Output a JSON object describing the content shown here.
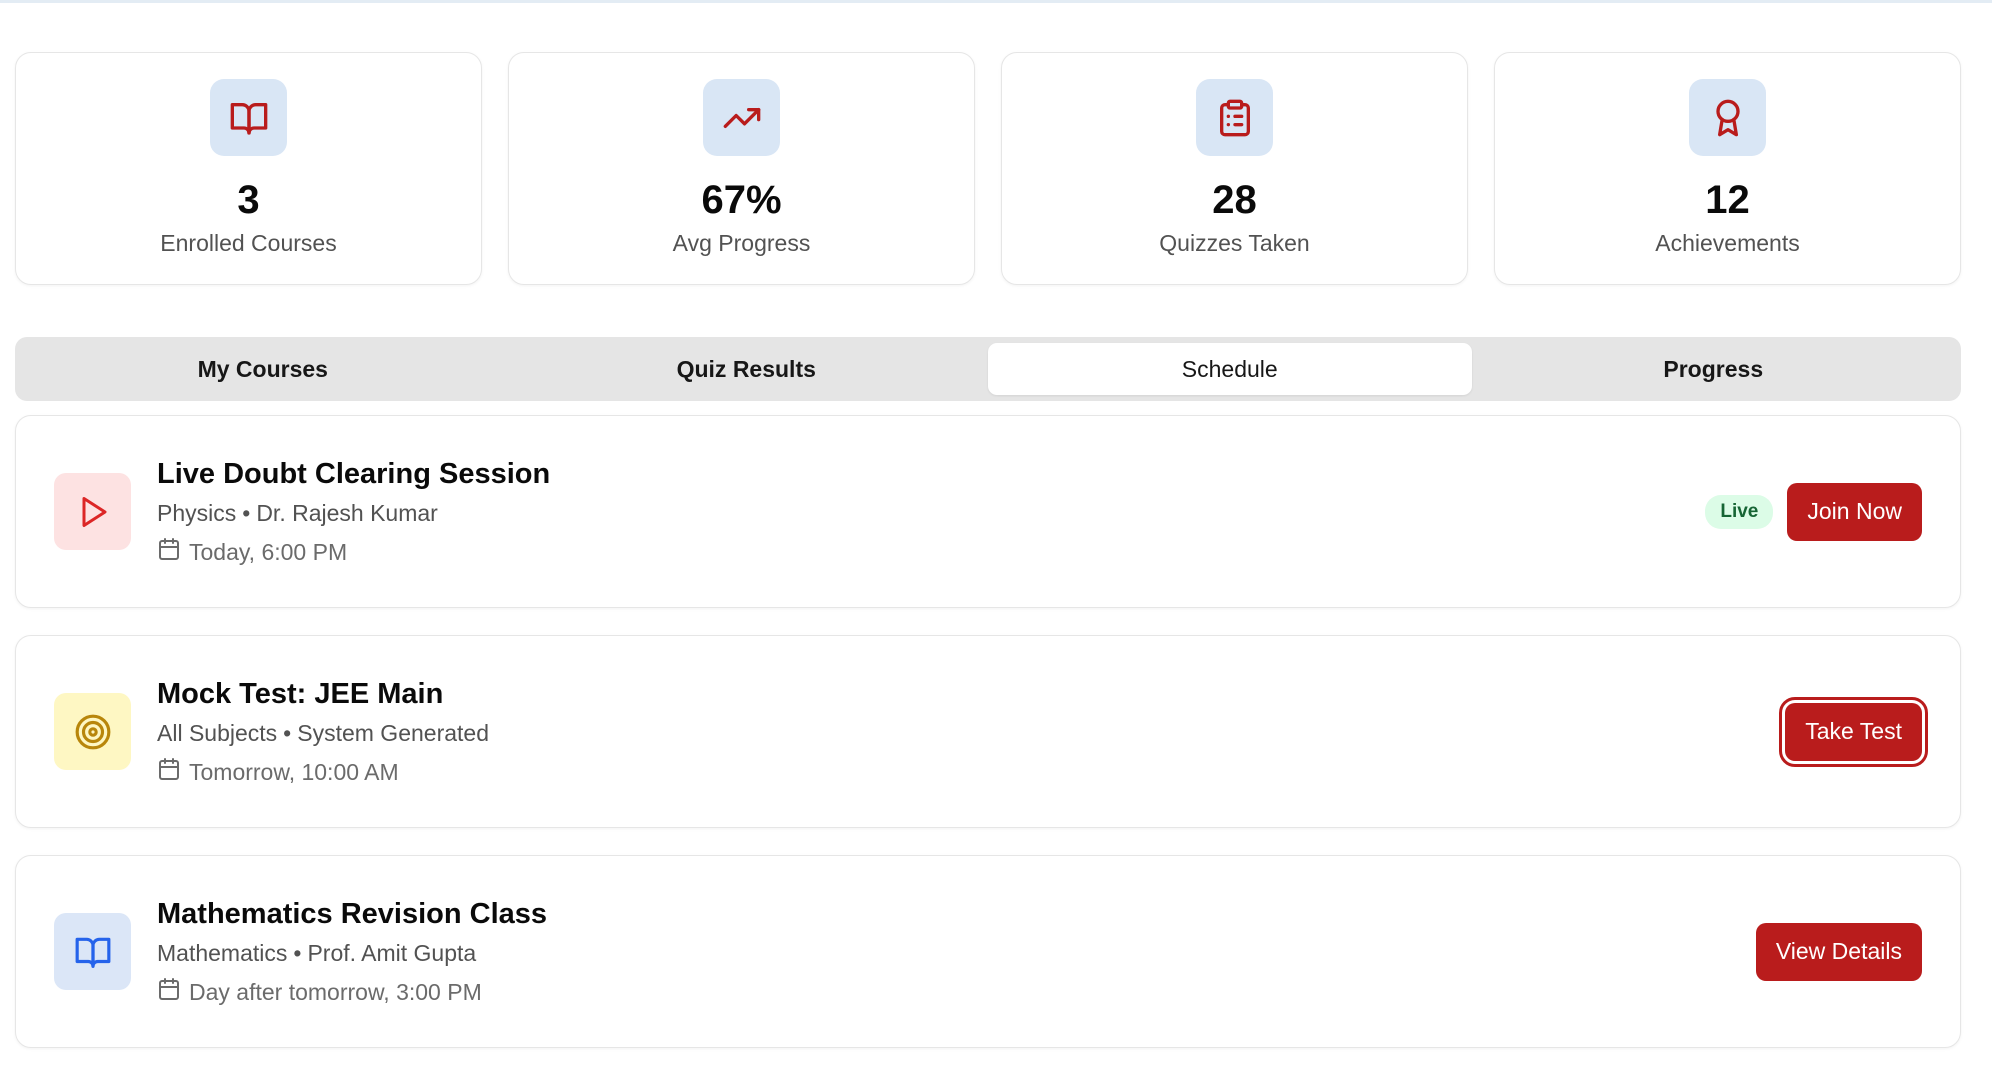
{
  "stats": [
    {
      "value": "3",
      "label": "Enrolled Courses",
      "icon": "book-open-icon"
    },
    {
      "value": "67%",
      "label": "Avg Progress",
      "icon": "trending-up-icon"
    },
    {
      "value": "28",
      "label": "Quizzes Taken",
      "icon": "clipboard-list-icon"
    },
    {
      "value": "12",
      "label": "Achievements",
      "icon": "award-icon"
    }
  ],
  "tabs": [
    {
      "label": "My Courses"
    },
    {
      "label": "Quiz Results"
    },
    {
      "label": "Schedule",
      "active": true
    },
    {
      "label": "Progress"
    }
  ],
  "schedule": [
    {
      "title": "Live Doubt Clearing Session",
      "subject": "Physics",
      "instructor": "Dr. Rajesh Kumar",
      "time": "Today, 6:00 PM",
      "badge": "Live",
      "action": "Join Now",
      "icon": "play-icon"
    },
    {
      "title": "Mock Test: JEE Main",
      "subject": "All Subjects",
      "instructor": "System Generated",
      "time": "Tomorrow, 10:00 AM",
      "action": "Take Test",
      "icon": "target-icon"
    },
    {
      "title": "Mathematics Revision Class",
      "subject": "Mathematics",
      "instructor": "Prof. Amit Gupta",
      "time": "Day after tomorrow, 3:00 PM",
      "action": "View Details",
      "icon": "book-open-icon"
    }
  ],
  "colors": {
    "accent": "#b91c1c",
    "icon_bg_blue": "#d9e6f5",
    "icon_bg_red": "#fde2e2",
    "icon_bg_yellow": "#fef7c3",
    "live_bg": "#dcfce7",
    "live_text": "#166534"
  }
}
